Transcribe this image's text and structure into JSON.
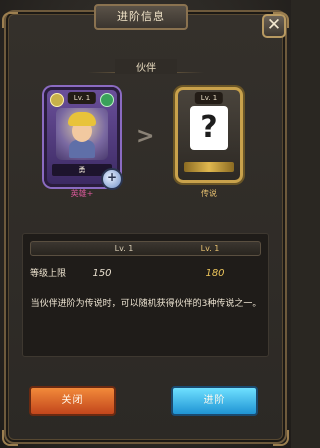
{
  "window": {
    "title": "进阶信息",
    "close_symbol": "✕"
  },
  "section": {
    "label": "伙伴"
  },
  "current_card": {
    "level": "Lv. 1",
    "name": "勇",
    "caption": "英雄+",
    "add_symbol": "+"
  },
  "target_card": {
    "level": "Lv. 1",
    "placeholder": "?",
    "caption": "传说"
  },
  "arrow_symbol": ">",
  "info": {
    "from_level": "Lv. 1",
    "to_level": "Lv. 1",
    "row_label": "等级上限",
    "from_value": "150",
    "to_value": "180",
    "description": "当伙伴进阶为传说时，可以随机获得伙伴的3种传说之一。"
  },
  "buttons": {
    "close_label": "关闭",
    "advance_label": "进阶"
  },
  "colors": {
    "accent_gold": "#e6c070",
    "caption_pink": "#d9599a",
    "close_orange": "#e06a2b",
    "advance_blue": "#3fb6ea"
  }
}
